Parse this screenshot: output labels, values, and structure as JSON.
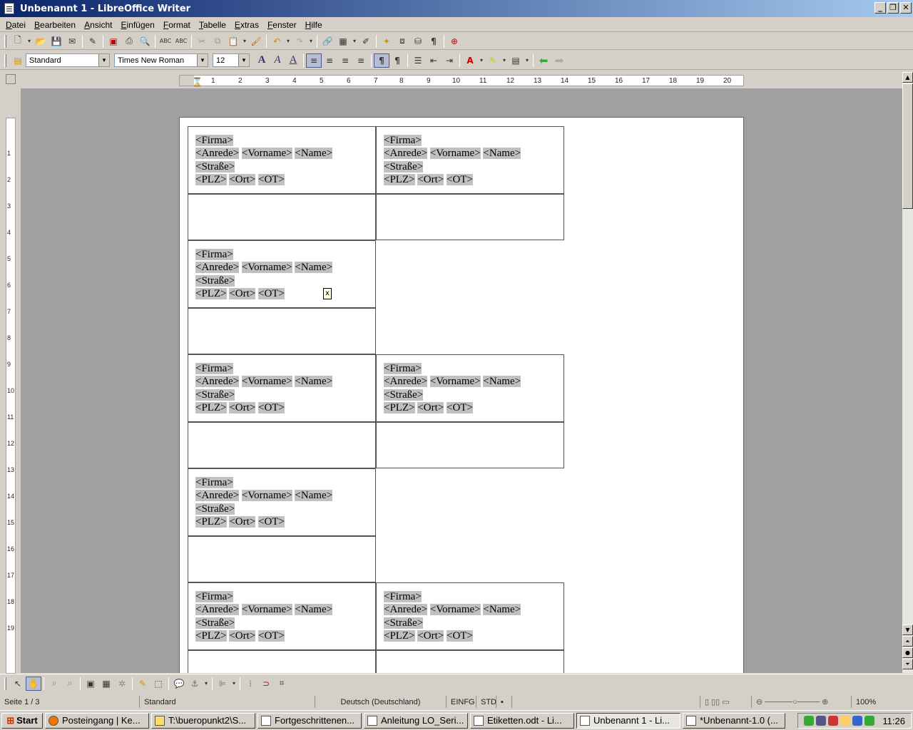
{
  "window": {
    "title": "Unbenannt 1 - LibreOffice Writer"
  },
  "menu": [
    "Datei",
    "Bearbeiten",
    "Ansicht",
    "Einfügen",
    "Format",
    "Tabelle",
    "Extras",
    "Fenster",
    "Hilfe"
  ],
  "format_bar": {
    "style": "Standard",
    "font": "Times New Roman",
    "size": "12"
  },
  "ruler": {
    "h_ticks": [
      "1",
      "2",
      "3",
      "4",
      "5",
      "6",
      "7",
      "8",
      "9",
      "10",
      "11",
      "12",
      "13",
      "14",
      "15",
      "16",
      "17",
      "18",
      "19",
      "20"
    ],
    "v_ticks": [
      "1",
      "2",
      "3",
      "4",
      "5",
      "6",
      "7",
      "8",
      "9",
      "10",
      "11",
      "12",
      "13",
      "14",
      "15",
      "16",
      "17",
      "18",
      "19"
    ]
  },
  "label": {
    "firma": "<Firma>",
    "anrede": "<Anrede>",
    "vorname": "<Vorname>",
    "name": "<Name>",
    "strasse": "<Straße>",
    "plz": "<PLZ>",
    "ort": "<Ort>",
    "ot": "<OT>"
  },
  "floating_cursor": "x",
  "status": {
    "page": "Seite 1 / 3",
    "style": "Standard",
    "language": "Deutsch (Deutschland)",
    "mode": "EINFG",
    "sel": "STD",
    "zoom": "100%"
  },
  "taskbar": {
    "start": "Start",
    "tasks": [
      "Posteingang | Ke...",
      "T:\\bueropunkt2\\S...",
      "Fortgeschrittenen...",
      "Anleitung LO_Seri...",
      "Etiketten.odt - Li...",
      "Unbenannt 1 - Li...",
      "*Unbenannt-1.0 (..."
    ],
    "clock": "11:26"
  }
}
